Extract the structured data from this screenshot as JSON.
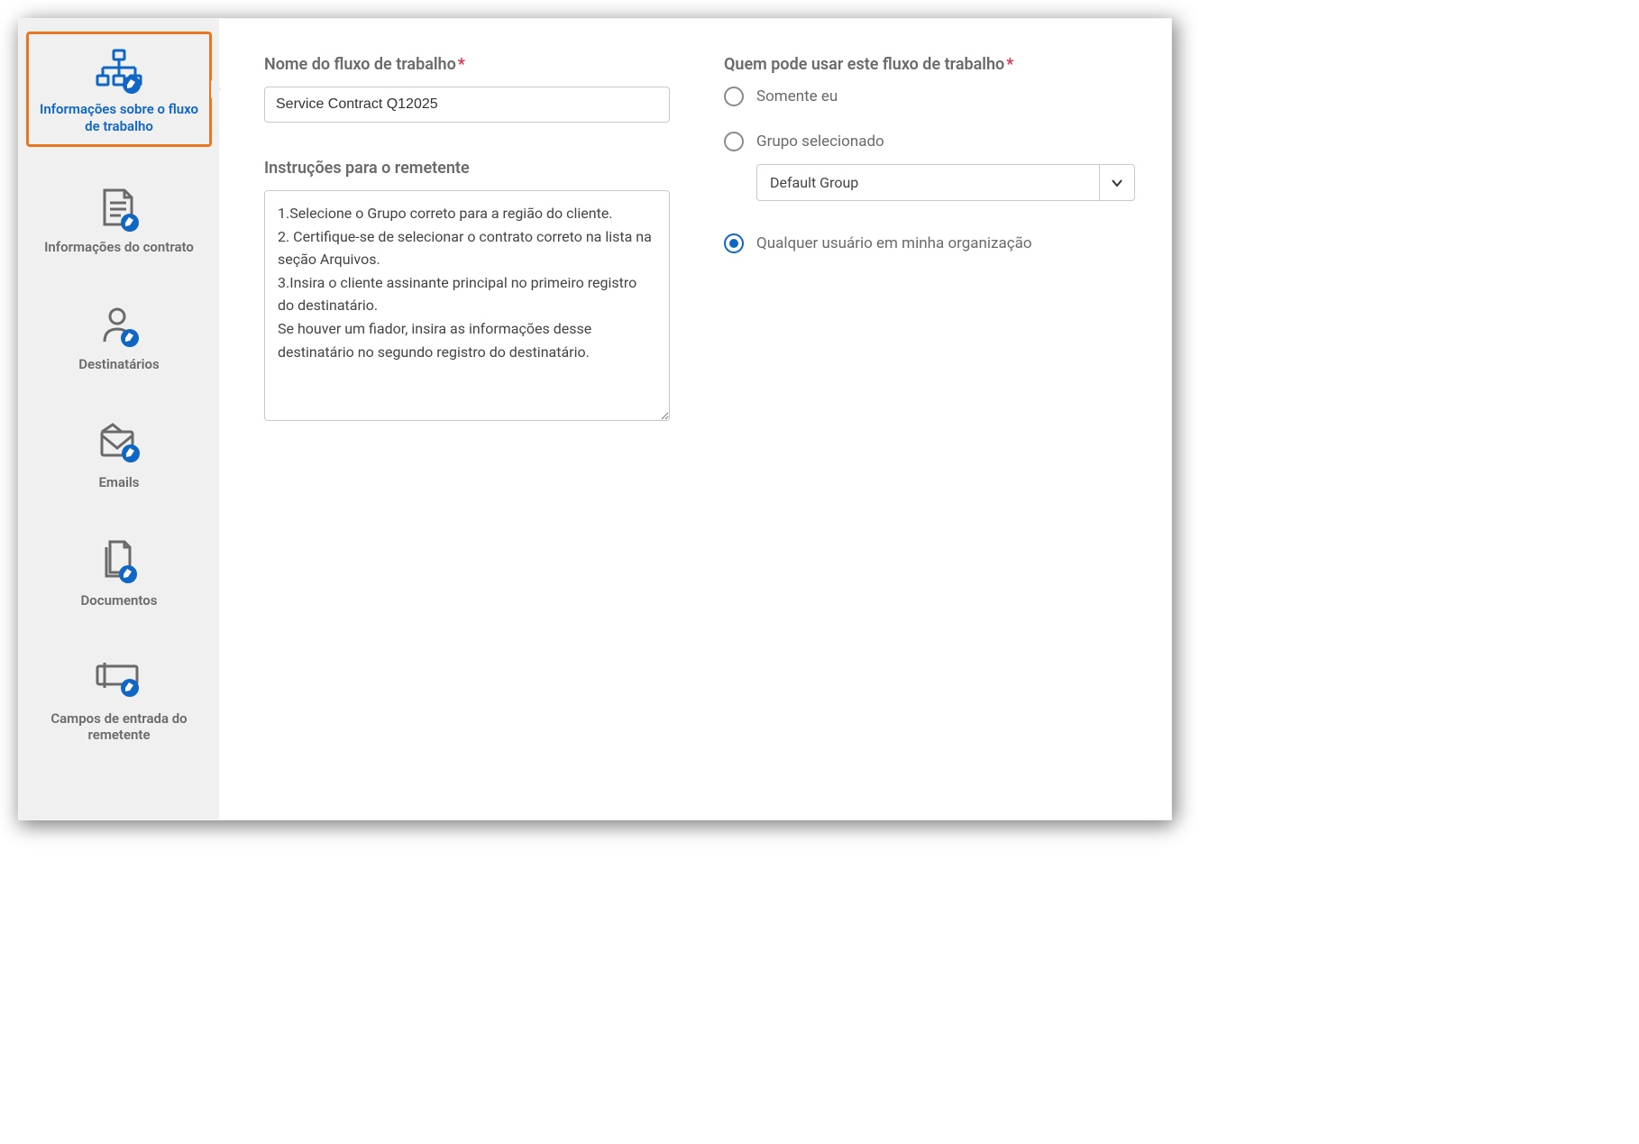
{
  "sidebar": {
    "items": [
      {
        "label": "Informações sobre o fluxo de trabalho"
      },
      {
        "label": "Informações do contrato"
      },
      {
        "label": "Destinatários"
      },
      {
        "label": "Emails"
      },
      {
        "label": "Documentos"
      },
      {
        "label": "Campos de entrada do remetente"
      }
    ]
  },
  "form": {
    "name_label": "Nome do fluxo de trabalho",
    "name_value": "Service Contract Q12025",
    "instructions_label": "Instruções para o remetente",
    "instructions_value": "1.Selecione o Grupo correto para a região do cliente.\n2. Certifique-se de selecionar o contrato correto na lista na seção Arquivos.\n3.Insira o cliente assinante principal no primeiro registro do destinatário.\nSe houver um fiador, insira as informações desse destinatário no segundo registro do destinatário.",
    "who_label": "Quem pode usar este fluxo de trabalho",
    "options": {
      "only_me": "Somente eu",
      "selected_group": "Grupo selecionado",
      "any_user": "Qualquer usuário em minha organização"
    },
    "group_value": "Default Group",
    "selected": "any_user",
    "required_marker": "*"
  }
}
